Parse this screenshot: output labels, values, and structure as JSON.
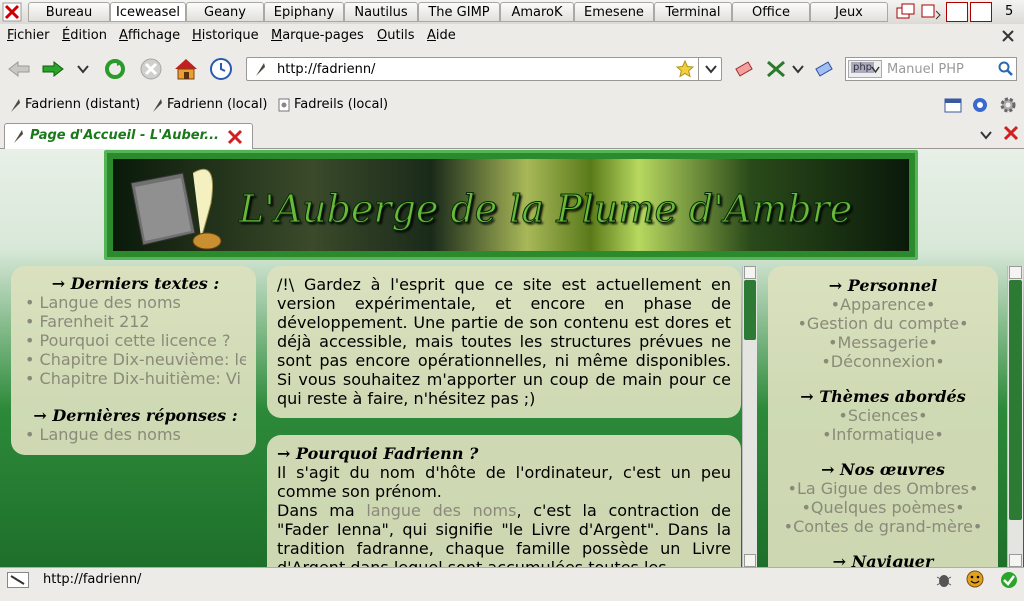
{
  "taskbar": {
    "tabs": [
      {
        "label": "Bureau"
      },
      {
        "label": "Iceweasel"
      },
      {
        "label": "Geany"
      },
      {
        "label": "Epiphany"
      },
      {
        "label": "Nautilus"
      },
      {
        "label": "The GIMP"
      },
      {
        "label": "AmaroK"
      },
      {
        "label": "Emesene"
      },
      {
        "label": "Terminal"
      },
      {
        "label": "Office"
      },
      {
        "label": "Jeux"
      }
    ],
    "workspace": "5"
  },
  "menubar": {
    "items": [
      "Fichier",
      "Édition",
      "Affichage",
      "Historique",
      "Marque-pages",
      "Outils",
      "Aide"
    ]
  },
  "navbar": {
    "url": "http://fadrienn/",
    "search_placeholder": "Manuel PHP",
    "search_engine": "php"
  },
  "bookmarks": {
    "items": [
      "Fadrienn (distant)",
      "Fadrienn (local)",
      "Fadreils (local)"
    ]
  },
  "tabs": {
    "active_title": "Page d'Accueil - L'Auber..."
  },
  "page": {
    "banner_title": "L'Auberge de la Plume d'Ambre",
    "left": {
      "latest_title": "→ Derniers textes :",
      "latest_items": [
        "Langue des noms",
        "Farenheit 212",
        "Pourquoi cette licence ?",
        "Chapitre Dix-neuvième: le",
        "Chapitre Dix-huitième: Vi"
      ],
      "replies_title": "→ Dernières réponses :",
      "replies_items": [
        "Langue des noms"
      ]
    },
    "notice": {
      "text": "/!\\ Gardez à l'esprit que ce site est actuellement en version expérimentale, et encore en phase de développement. Une partie de son contenu est dores et déjà accessible, mais toutes les structures prévues ne sont pas encore opérationnelles, ni même disponibles. Si vous souhaitez m'apporter un coup de main pour ce qui reste à faire, n'hésitez pas ;)"
    },
    "why": {
      "title": "→ Pourquoi Fadrienn ?",
      "p1": "Il s'agit du nom d'hôte de l'ordinateur, c'est un peu comme son prénom.",
      "p2_before": "Dans ma ",
      "p2_link": "langue des noms",
      "p2_after": ", c'est la contraction de \"Fader Ienna\", qui signifie \"le Livre d'Argent\". Dans la tradition fadranne, chaque famille possède un Livre d'Argent dans lequel sont accumulées toutes les"
    },
    "right": {
      "personal_title": "→ Personnel",
      "personal_items": [
        "Apparence",
        "Gestion du compte",
        "Messagerie",
        "Déconnexion"
      ],
      "themes_title": "→ Thèmes abordés",
      "themes_items": [
        "Sciences",
        "Informatique"
      ],
      "works_title": "→ Nos œuvres",
      "works_items": [
        "La Gigue des Ombres",
        "Quelques poèmes",
        "Contes de grand-mère"
      ],
      "nav_title": "→ Naviguer"
    }
  },
  "status": {
    "url": "http://fadrienn/"
  }
}
